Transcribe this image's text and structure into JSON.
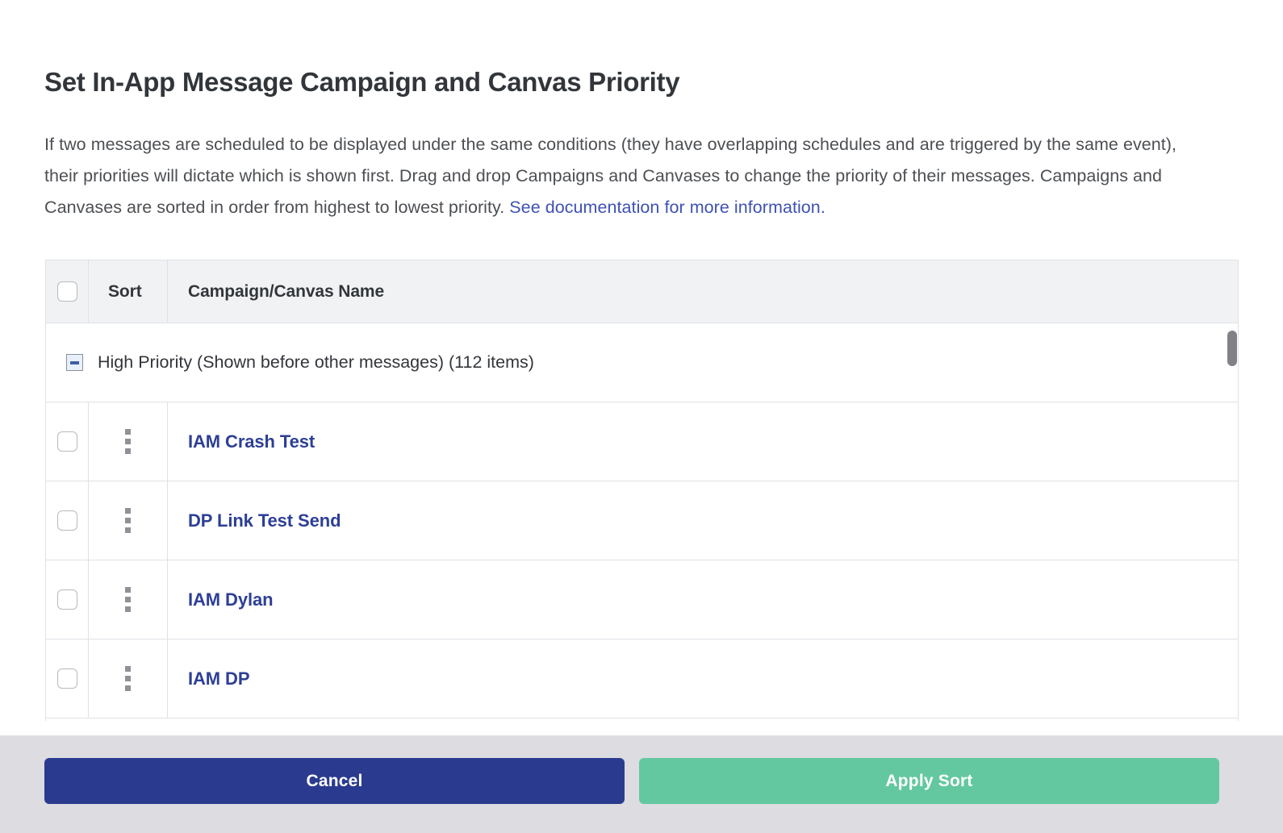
{
  "dialog": {
    "title": "Set In-App Message Campaign and Canvas Priority",
    "description_part1": "If two messages are scheduled to be displayed under the same conditions (they have overlapping schedules and are triggered by the same event), their priorities will dictate which is shown first. Drag and drop Campaigns and Canvases to change the priority of their messages. Campaigns and Canvases are sorted in order from highest to lowest priority. ",
    "description_link": "See documentation for more information."
  },
  "table": {
    "columns": {
      "select_all": "",
      "sort": "Sort",
      "name": "Campaign/Canvas Name"
    },
    "group": {
      "label": "High Priority (Shown before other messages) (112 items)",
      "collapse_icon": "minus-square-icon",
      "expanded": true
    },
    "rows": [
      {
        "name": "IAM Crash Test",
        "checked": false,
        "handle_icon": "drag-handle-icon"
      },
      {
        "name": "DP Link Test Send",
        "checked": false,
        "handle_icon": "drag-handle-icon"
      },
      {
        "name": "IAM Dylan",
        "checked": false,
        "handle_icon": "drag-handle-icon"
      },
      {
        "name": "IAM DP",
        "checked": false,
        "handle_icon": "drag-handle-icon"
      }
    ]
  },
  "footer": {
    "cancel_label": "Cancel",
    "apply_label": "Apply Sort"
  },
  "colors": {
    "title": "#32363b",
    "link": "#3f51b5",
    "row_link": "#2d3f95",
    "header_bg": "#f1f2f4",
    "border": "#dfe1e5",
    "footer_bg": "#dcdce1",
    "cancel_bg": "#2a3b8f",
    "apply_bg": "#63c8a0",
    "scrollbar_thumb": "#808287"
  }
}
